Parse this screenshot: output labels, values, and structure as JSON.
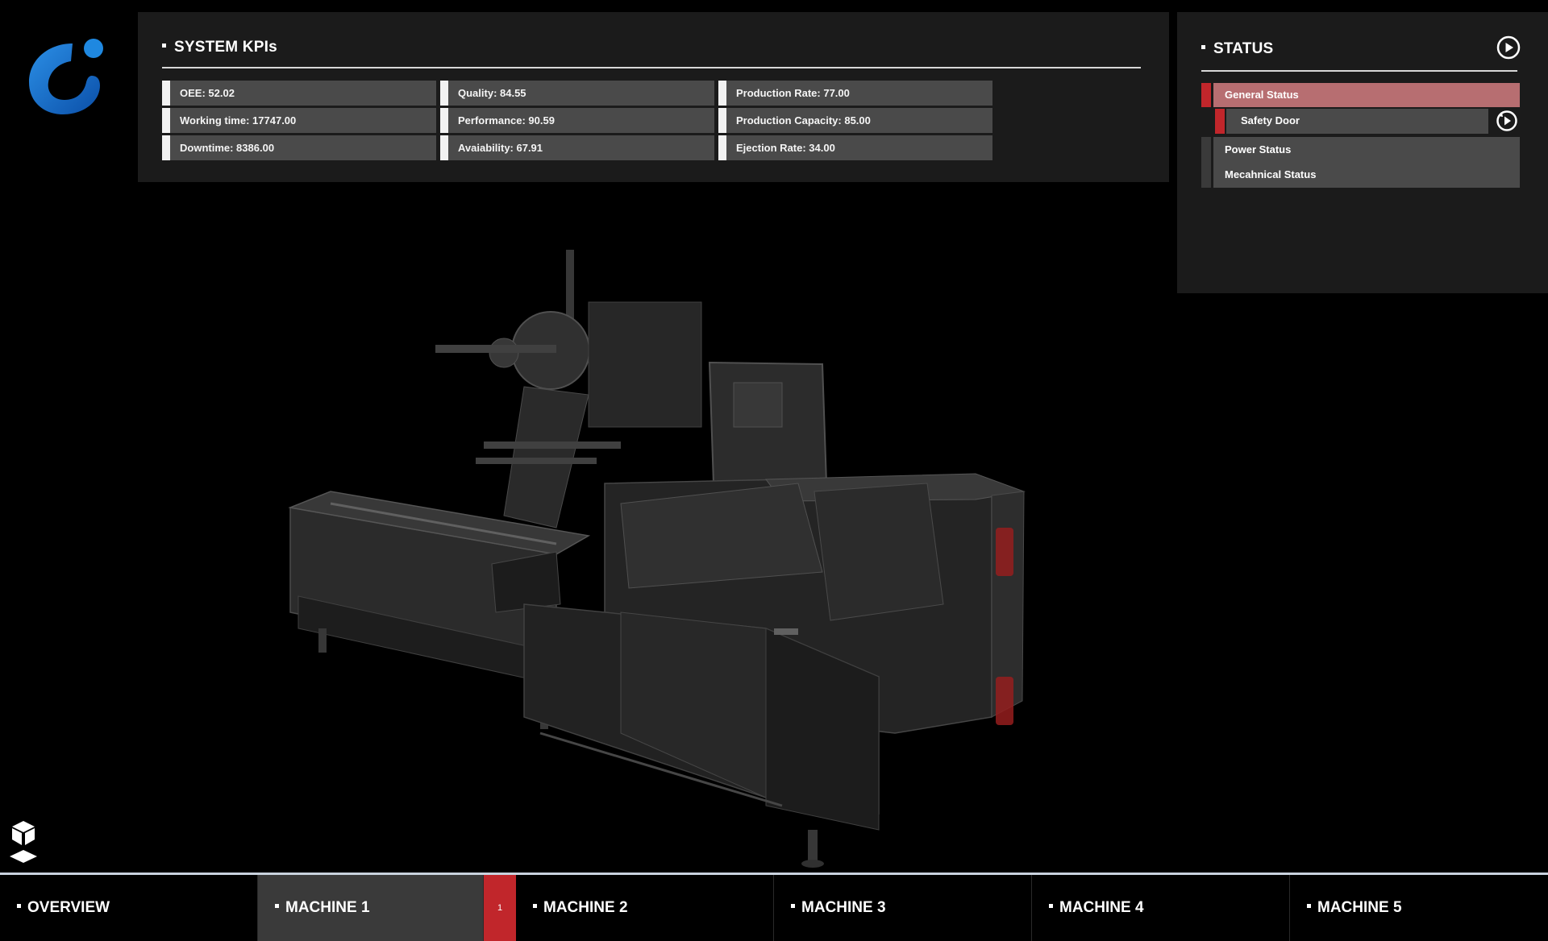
{
  "logo": {
    "icon": "company-logo-icon",
    "colors": [
      "#1a76d2",
      "#0d47a1"
    ]
  },
  "kpis": {
    "title": "SYSTEM KPIs",
    "columns": [
      [
        "OEE: 52.02",
        "Working time: 17747.00",
        "Downtime: 8386.00"
      ],
      [
        "Quality: 84.55",
        "Performance: 90.59",
        "Avaiability: 67.91"
      ],
      [
        "Production Rate: 77.00",
        "Production Capacity: 85.00",
        "Ejection Rate: 34.00"
      ]
    ]
  },
  "status": {
    "title": "STATUS",
    "play_icon": "play-circle-icon",
    "items": [
      {
        "label": "General Status",
        "state": "alarm"
      },
      {
        "label": "Safety Door",
        "state": "alarm"
      },
      {
        "label": "Power Status",
        "state": "normal"
      },
      {
        "label": "Mecahnical Status",
        "state": "normal"
      }
    ],
    "colors": {
      "alarm": "#c1262b",
      "alarm_bg": "#b76e71"
    }
  },
  "view_control": {
    "icon": "3d-cube-icon"
  },
  "nav": {
    "tabs": [
      {
        "label": "OVERVIEW"
      },
      {
        "label": "MACHINE 1",
        "active": true,
        "badge": "1"
      },
      {
        "label": "MACHINE 2"
      },
      {
        "label": "MACHINE 3"
      },
      {
        "label": "MACHINE 4"
      },
      {
        "label": "MACHINE 5"
      }
    ]
  }
}
